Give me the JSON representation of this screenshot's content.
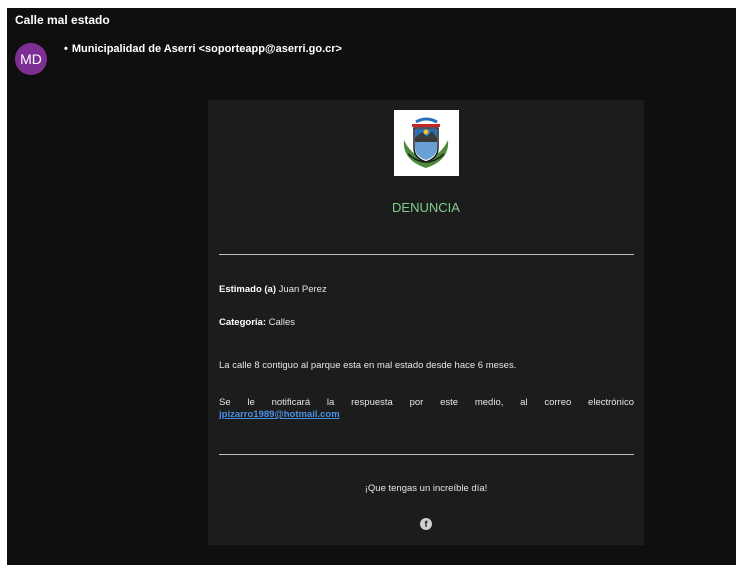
{
  "email": {
    "subject": "Calle mal estado",
    "avatar_initials": "MD",
    "sender_bullet": "•",
    "sender": "Municipalidad de Aserri <soporteapp@aserri.go.cr>"
  },
  "message": {
    "title": "DENUNCIA",
    "greeting_label": "Estimado (a)",
    "greeting_name": "Juan Perez",
    "category_label": "Categoría:",
    "category_value": "Calles",
    "body": "La calle 8 contiguo al parque esta en mal estado desde hace 6 meses.",
    "notify_text": "Se le notificará la respuesta por este medio, al correo electrónico",
    "notify_email": "jpizarro1989@hotmail.com",
    "closing": "¡Que tengas un increíble día!",
    "facebook_icon_glyph": "f"
  },
  "colors": {
    "background": "#0f0f0f",
    "card": "#1c1c1c",
    "title_green": "#7fd18a",
    "avatar_purple": "#7e2f93",
    "link_blue": "#4a90e2"
  }
}
